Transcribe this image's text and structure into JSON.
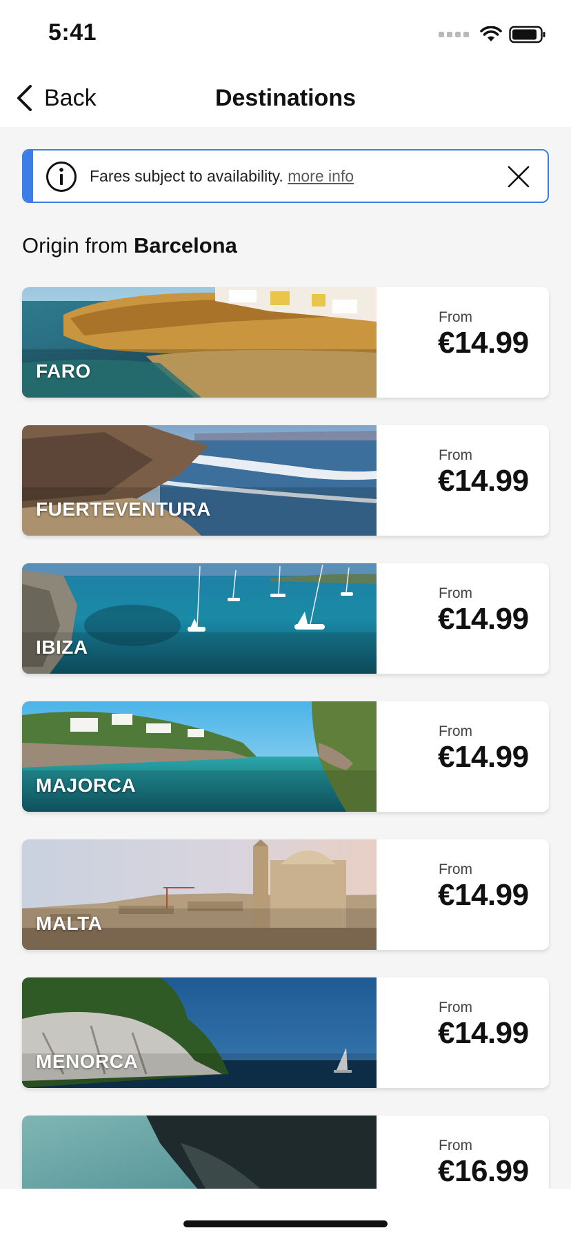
{
  "status_bar": {
    "time": "5:41",
    "icons": [
      "cellular-signal-icon",
      "wifi-icon",
      "battery-icon"
    ]
  },
  "nav": {
    "back_label": "Back",
    "title": "Destinations"
  },
  "banner": {
    "message": "Fares subject to availability.",
    "link_label": "more info",
    "accent_color": "#3c7ee8",
    "icons": [
      "info-icon",
      "close-icon"
    ]
  },
  "origin": {
    "prefix": "Origin from",
    "city": "Barcelona"
  },
  "destinations": [
    {
      "name": "FARO",
      "from_label": "From",
      "price": "€14.99"
    },
    {
      "name": "FUERTEVENTURA",
      "from_label": "From",
      "price": "€14.99"
    },
    {
      "name": "IBIZA",
      "from_label": "From",
      "price": "€14.99"
    },
    {
      "name": "MAJORCA",
      "from_label": "From",
      "price": "€14.99"
    },
    {
      "name": "MALTA",
      "from_label": "From",
      "price": "€14.99"
    },
    {
      "name": "MENORCA",
      "from_label": "From",
      "price": "€14.99"
    },
    {
      "name": "",
      "from_label": "From",
      "price": "€16.99"
    }
  ]
}
